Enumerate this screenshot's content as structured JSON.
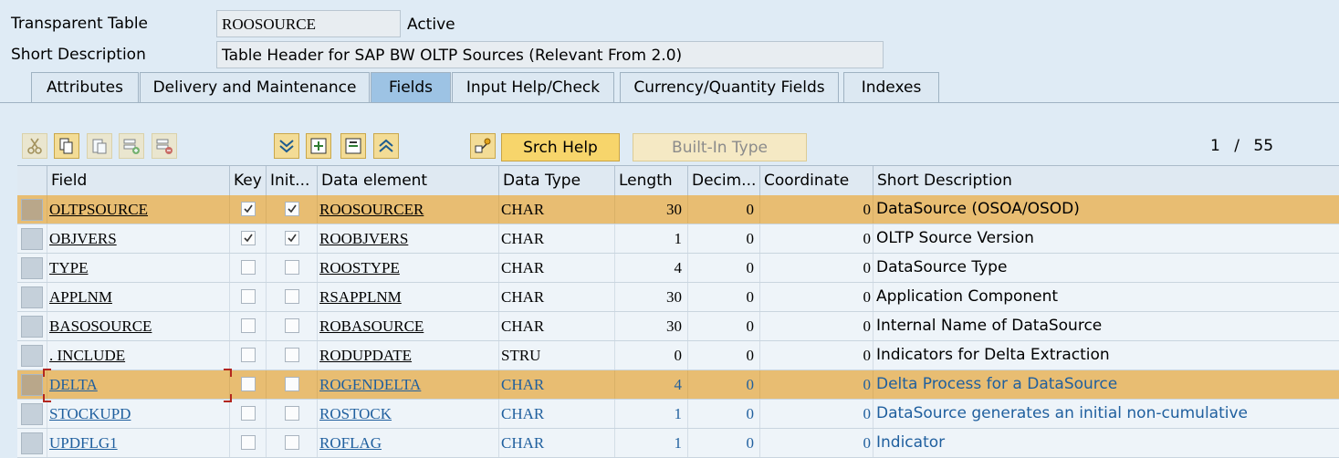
{
  "header": {
    "table_type_label": "Transparent Table",
    "table_name": "ROOSOURCE",
    "status": "Active",
    "short_desc_label": "Short Description",
    "short_desc_value": "Table Header for SAP BW OLTP Sources (Relevant From 2.0)"
  },
  "tabs": [
    {
      "label": "Attributes",
      "active": false
    },
    {
      "label": "Delivery and Maintenance",
      "active": false
    },
    {
      "label": "Fields",
      "active": true
    },
    {
      "label": "Input Help/Check",
      "active": false
    },
    {
      "label": "Currency/Quantity Fields",
      "active": false
    },
    {
      "label": "Indexes",
      "active": false
    }
  ],
  "toolbar": {
    "icons": [
      "cut-icon",
      "copy-icon",
      "paste-icon",
      "insert-row-icon",
      "delete-row-icon",
      "scroll-down-icon",
      "expand-icon",
      "collapse-icon",
      "scroll-up-icon",
      "hierarchy-icon"
    ],
    "srch_help_label": "Srch Help",
    "built_in_type_label": "Built-In Type",
    "pager_current": "1",
    "pager_separator": "/",
    "pager_total": "55"
  },
  "table": {
    "columns": [
      "Field",
      "Key",
      "Init...",
      "Data element",
      "Data Type",
      "Length",
      "Decim...",
      "Coordinate",
      "Short Description"
    ],
    "rows": [
      {
        "field": "OLTPSOURCE",
        "key": true,
        "init": true,
        "data_element": "ROOSOURCER",
        "data_type": "CHAR",
        "length": "30",
        "decimals": "0",
        "coordinate": "0",
        "description": "DataSource (OSOA/OSOD)",
        "selected": true,
        "blue": false
      },
      {
        "field": "OBJVERS",
        "key": true,
        "init": true,
        "data_element": "ROOBJVERS",
        "data_type": "CHAR",
        "length": "1",
        "decimals": "0",
        "coordinate": "0",
        "description": "OLTP Source Version",
        "selected": false,
        "blue": false
      },
      {
        "field": "TYPE",
        "key": false,
        "init": false,
        "data_element": "ROOSTYPE",
        "data_type": "CHAR",
        "length": "4",
        "decimals": "0",
        "coordinate": "0",
        "description": "DataSource Type",
        "selected": false,
        "blue": false
      },
      {
        "field": "APPLNM",
        "key": false,
        "init": false,
        "data_element": "RSAPPLNM",
        "data_type": "CHAR",
        "length": "30",
        "decimals": "0",
        "coordinate": "0",
        "description": "Application Component",
        "selected": false,
        "blue": false
      },
      {
        "field": "BASOSOURCE",
        "key": false,
        "init": false,
        "data_element": "ROBASOURCE",
        "data_type": "CHAR",
        "length": "30",
        "decimals": "0",
        "coordinate": "0",
        "description": "Internal Name of DataSource",
        "selected": false,
        "blue": false
      },
      {
        "field": ". INCLUDE",
        "key": false,
        "init": false,
        "data_element": "RODUPDATE",
        "data_type": "STRU",
        "length": "0",
        "decimals": "0",
        "coordinate": "0",
        "description": "Indicators for Delta Extraction",
        "selected": false,
        "blue": false
      },
      {
        "field": "DELTA",
        "key": false,
        "init": false,
        "data_element": "ROGENDELTA",
        "data_type": "CHAR",
        "length": "4",
        "decimals": "0",
        "coordinate": "0",
        "description": "Delta Process for a DataSource",
        "selected": true,
        "blue": true
      },
      {
        "field": "STOCKUPD",
        "key": false,
        "init": false,
        "data_element": "ROSTOCK",
        "data_type": "CHAR",
        "length": "1",
        "decimals": "0",
        "coordinate": "0",
        "description": "DataSource generates an initial non-cumulative",
        "selected": false,
        "blue": true
      },
      {
        "field": "UPDFLG1",
        "key": false,
        "init": false,
        "data_element": "ROFLAG",
        "data_type": "CHAR",
        "length": "1",
        "decimals": "0",
        "coordinate": "0",
        "description": "Indicator",
        "selected": false,
        "blue": true
      }
    ]
  }
}
